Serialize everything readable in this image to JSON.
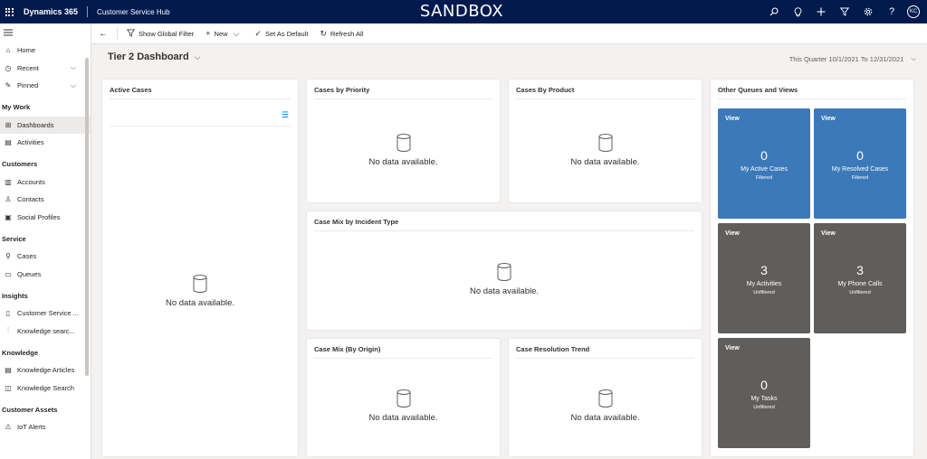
{
  "topbar": {
    "brand": "Dynamics 365",
    "app_name": "Customer Service Hub",
    "environment": "SANDBOX",
    "avatar_initials": "KC",
    "icons": [
      "search-icon",
      "lightbulb-icon",
      "plus-icon",
      "filter-icon",
      "gear-icon",
      "help-icon"
    ]
  },
  "sidebar": {
    "items_top": [
      {
        "label": "Home",
        "icon": "home-icon"
      },
      {
        "label": "Recent",
        "icon": "clock-icon"
      },
      {
        "label": "Pinned",
        "icon": "pin-icon"
      }
    ],
    "groups": {
      "my_work": "My Work",
      "customers": "Customers",
      "service": "Service",
      "insights": "Insights",
      "knowledge": "Knowledge",
      "customer_assets": "Customer Assets"
    },
    "my_work": [
      {
        "label": "Dashboards"
      },
      {
        "label": "Activities"
      }
    ],
    "customers": [
      {
        "label": "Accounts"
      },
      {
        "label": "Contacts"
      },
      {
        "label": "Social Profiles"
      }
    ],
    "service": [
      {
        "label": "Cases"
      },
      {
        "label": "Queues"
      }
    ],
    "insights": [
      {
        "label": "Customer Service ..."
      },
      {
        "label": "Knowledge searc..."
      }
    ],
    "knowledge": [
      {
        "label": "Knowledge Articles"
      },
      {
        "label": "Knowledge Search"
      }
    ],
    "customer_assets": [
      {
        "label": "IoT Alerts"
      }
    ]
  },
  "commandbar": {
    "show_global_filter": "Show Global Filter",
    "new": "New",
    "set_as_default": "Set As Default",
    "refresh_all": "Refresh All"
  },
  "dashboard": {
    "title": "Tier 2 Dashboard",
    "period": "This Quarter 10/1/2021 To 12/31/2021"
  },
  "cards": {
    "no_data": "No data available.",
    "active_cases": "Active Cases",
    "cases_by_priority": "Cases by Priority",
    "cases_by_product": "Cases By Product",
    "case_mix_incident": "Case Mix by Incident Type",
    "case_mix_origin": "Case Mix (By Origin)",
    "case_resolution": "Case Resolution Trend",
    "other_queues": "Other Queues and Views"
  },
  "tiles": [
    {
      "view": "View",
      "count": "0",
      "label": "My Active Cases",
      "filter": "Filtered",
      "color": "#3b79b9"
    },
    {
      "view": "View",
      "count": "0",
      "label": "My Resolved Cases",
      "filter": "Filtered",
      "color": "#3b79b9"
    },
    {
      "view": "View",
      "count": "3",
      "label": "My Activities",
      "filter": "Unfiltered",
      "color": "#605e5c"
    },
    {
      "view": "View",
      "count": "3",
      "label": "My Phone Calls",
      "filter": "Unfiltered",
      "color": "#605e5c"
    },
    {
      "view": "View",
      "count": "0",
      "label": "My Tasks",
      "filter": "Unfiltered",
      "color": "#605e5c"
    }
  ]
}
